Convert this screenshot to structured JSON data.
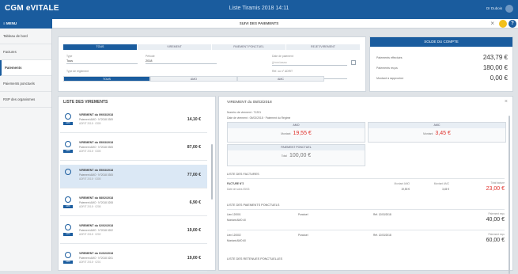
{
  "app": {
    "brand": "CGM eVITALE",
    "window_title": "Liste Tiramis 2018 14:11",
    "user": "Dr Dubois"
  },
  "subbar": {
    "menu_label": "≡ MENU",
    "title": "SUIVI DES PAIEMENTS"
  },
  "sidebar": {
    "items": [
      {
        "label": "Tableau de bord"
      },
      {
        "label": "Factures"
      },
      {
        "label": "Paiements",
        "active": true
      },
      {
        "label": "Paiements ponctuels"
      },
      {
        "label": "RSP des organismes"
      }
    ]
  },
  "filters": {
    "tabs": [
      "TOUS",
      "VIREMENT",
      "PAIEMENT PONCTUEL",
      "REJET/VIREMENT"
    ],
    "active_tab": "TOUS",
    "type_label": "Type",
    "type_value": "Tous",
    "period_label": "Période",
    "period_value": "2018",
    "date_label": "Date de paiement",
    "date_placeholder": "jj/mm/aaaa",
    "amount_label": "Réf. ou n° ADRIT",
    "segmented_label": "Type de règlement",
    "segments": [
      "TOUS",
      "AMO",
      "AMC"
    ],
    "active_segment": "TOUS"
  },
  "solde": {
    "header": "SOLDE DU COMPTE",
    "rows": [
      {
        "label": "Paiements effectués",
        "value": "243,79 €"
      },
      {
        "label": "Paiements reçus",
        "value": "180,00 €"
      },
      {
        "label": "Montant à rapprocher",
        "value": "0,00 €"
      }
    ]
  },
  "list": {
    "title": "LISTE DES VIREMENTS",
    "items": [
      {
        "title": "VIREMENT du 09/03/2018",
        "sub": "Paiement AMO · N°2018 0309",
        "meta": "ADRIT 2018 · 0309",
        "tag": "AMO",
        "amount": "14,10 €"
      },
      {
        "title": "VIREMENT du 05/03/2018",
        "sub": "Paiement AMO · N°2018 0305",
        "meta": "ADRIT 2018 · 0305",
        "tag": "AMO",
        "amount": "87,00 €"
      },
      {
        "title": "VIREMENT du 05/03/2018",
        "sub": "Paiement AMO · N°2018 0305",
        "meta": "ADRIT 2018 · 0305",
        "tag": "AMO",
        "amount": "77,00 €",
        "selected": true
      },
      {
        "title": "VIREMENT du 08/02/2018",
        "sub": "Paiement AMO · N°2018 0208",
        "meta": "ADRIT 2018 · 0208",
        "tag": "AMO",
        "amount": "6,90 €"
      },
      {
        "title": "VIREMENT du 02/02/2018",
        "sub": "Paiement AMO · N°2018 0202",
        "meta": "ADRIT 2018 · 0202",
        "tag": "AMO",
        "amount": "19,00 €"
      },
      {
        "title": "VIREMENT du 01/02/2018",
        "sub": "Paiement AMO · N°2018 0201",
        "meta": "ADRIT 2018 · 0201",
        "tag": "AMO",
        "amount": "19,00 €"
      }
    ]
  },
  "detail": {
    "title": "VIREMENT du 05/03/2018",
    "info1": "Numéro de virement : 71201",
    "info2": "Date de virement : 05/03/2018 · Paiement du Régime",
    "boxes": [
      {
        "header": "AMO",
        "label": "Montant",
        "value": "19,55 €",
        "red": true
      },
      {
        "header": "AMC",
        "label": "Montant",
        "value": "3,45 €",
        "red": true
      },
      {
        "header": "PAIEMENT PONCTUEL",
        "label": "Total",
        "value": "100,00 €",
        "red": false
      }
    ],
    "factures_title": "LISTE DES FACTURES",
    "facture": {
      "name": "FACTURE N°2",
      "patient": "Date de soins 05/03",
      "c1_label": "Montant AMO",
      "c1": "19,55 €",
      "c2_label": "Montant AMC",
      "c2": "3,45 €",
      "c3_label": "Total facture",
      "c3": "23,00 €"
    },
    "ponctuels_title": "LISTE DES PAIEMENTS PONCTUELS",
    "ponctuels": [
      {
        "a": "Lien 120001",
        "b": "Montant AMO 40",
        "c": "Ponctuel",
        "d": "Réf. 12/03/2018",
        "e": "Paiement reçu",
        "amount": "40,00 €"
      },
      {
        "a": "Lien 120002",
        "b": "Montant AMO 60",
        "c": "Ponctuel",
        "d": "Réf. 12/03/2018",
        "e": "Paiement reçu",
        "amount": "60,00 €"
      }
    ],
    "retenues_title": "LISTE DES RETENUES PONCTUELLES"
  }
}
